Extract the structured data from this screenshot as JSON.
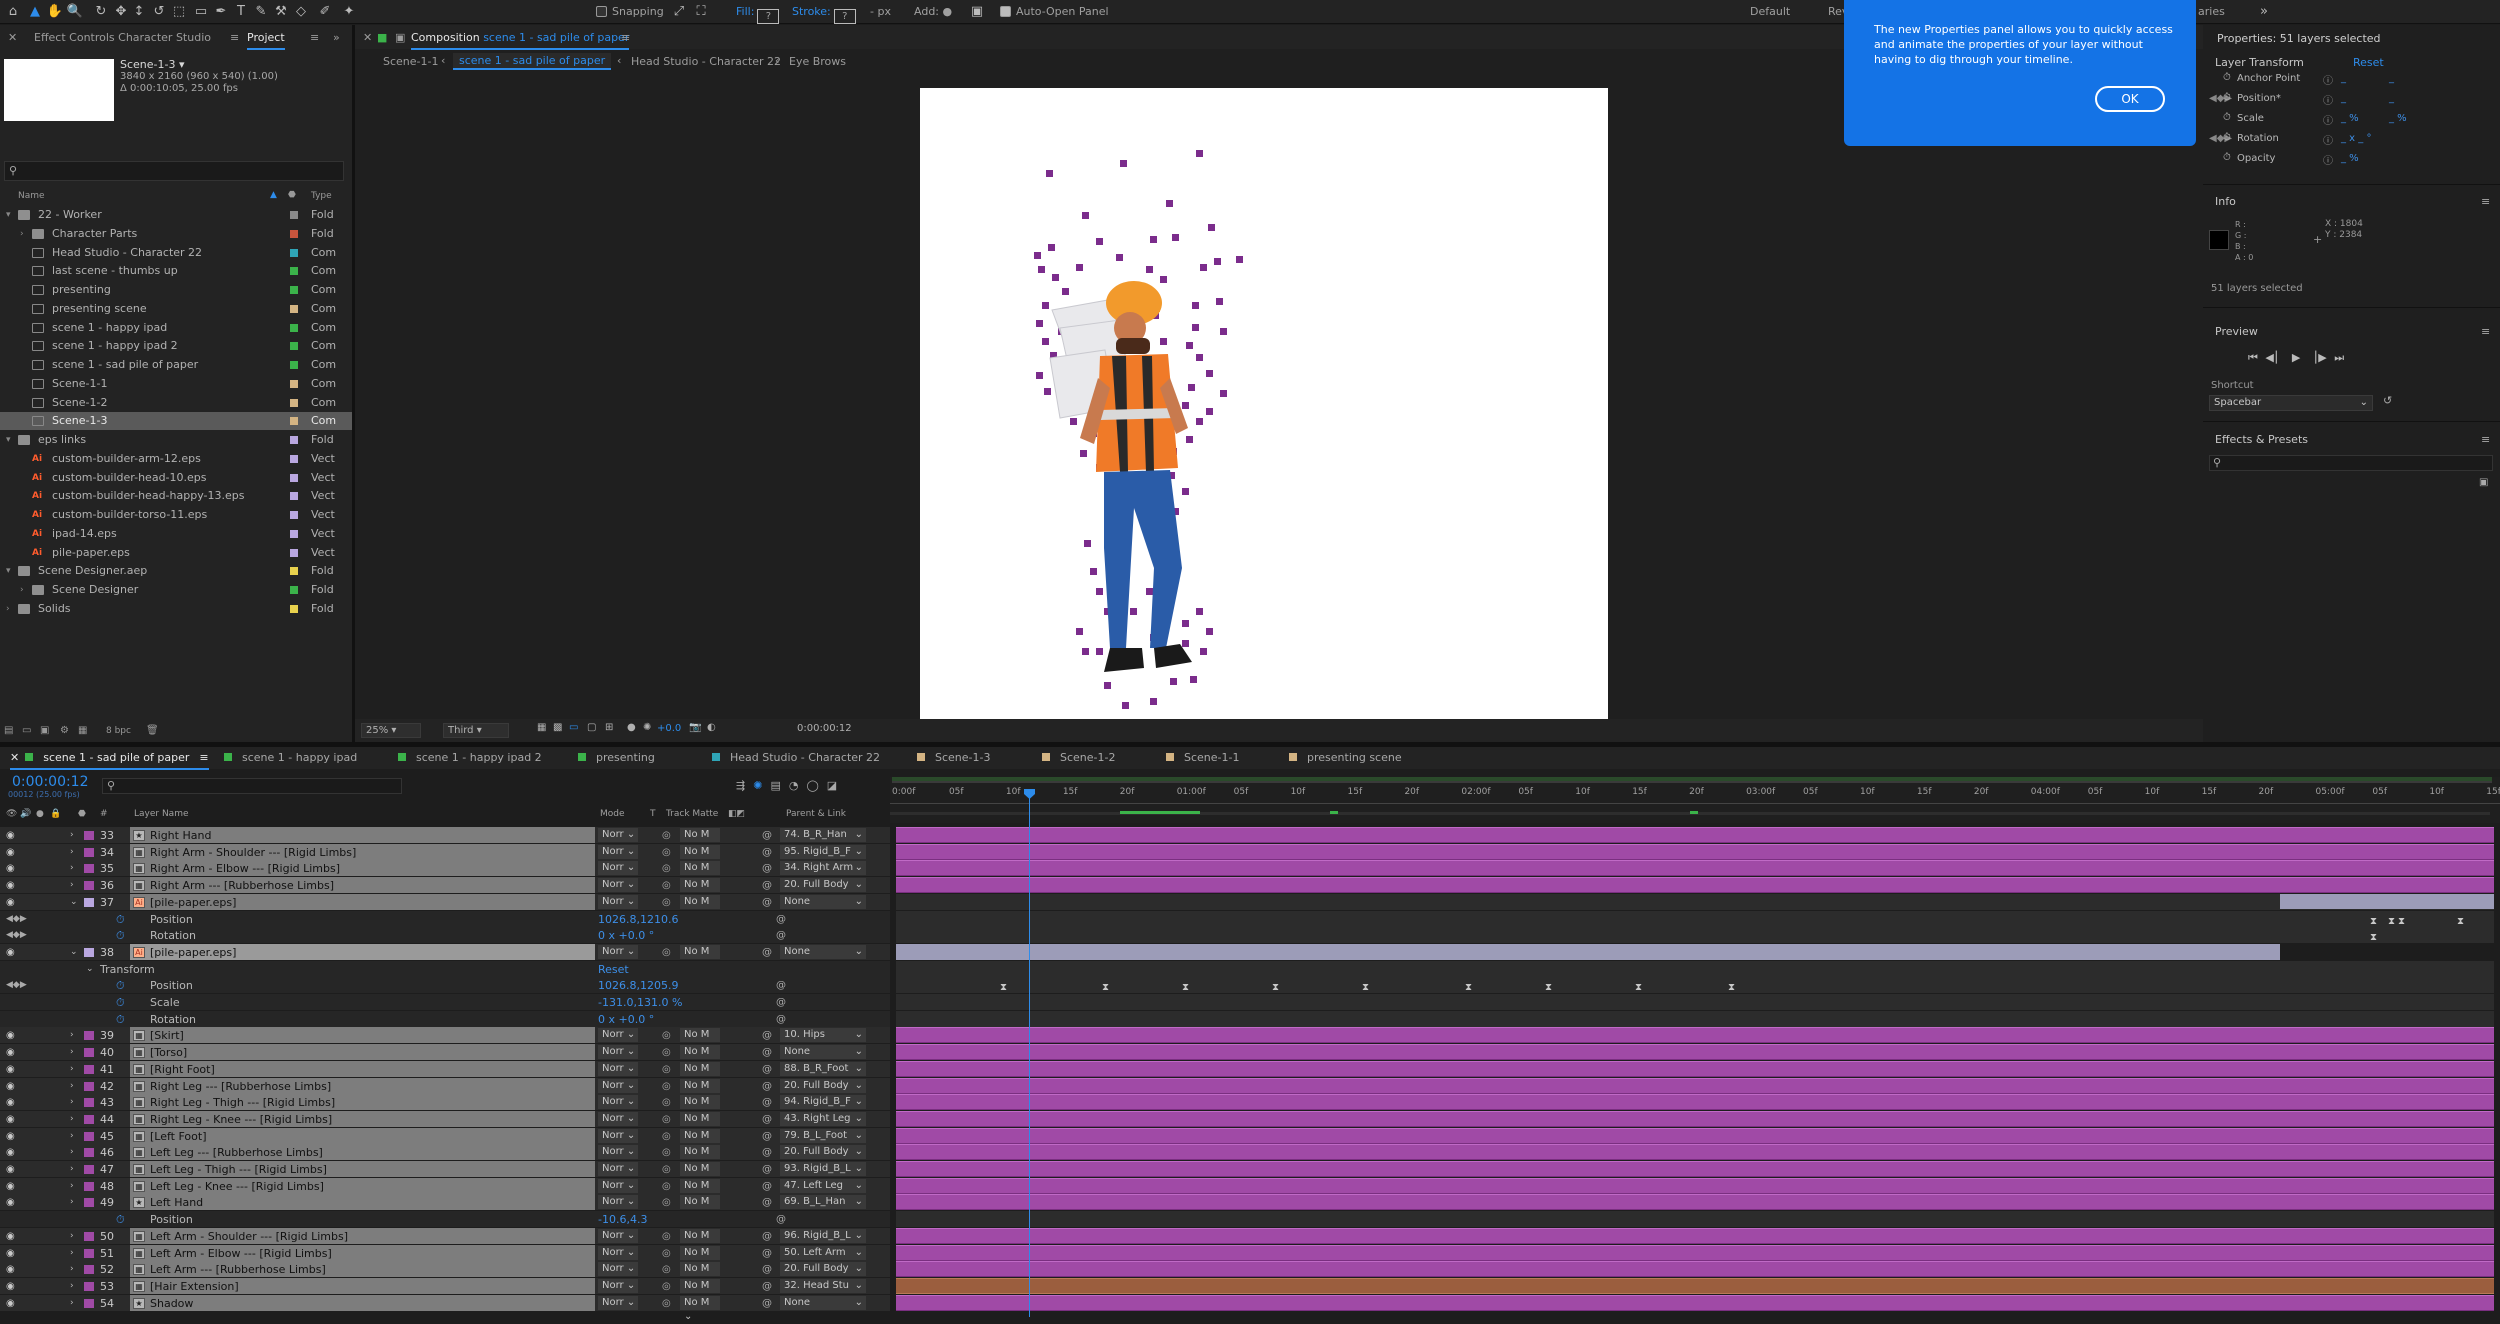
{
  "toolbar": {
    "snapping_label": "Snapping",
    "fill_label": "Fill:",
    "fill_value": "?",
    "stroke_label": "Stroke:",
    "stroke_value": "?",
    "px_label": "- px",
    "add_label": "Add:",
    "auto_open_label": "Auto-Open Panel",
    "workspace_default": "Default",
    "workspace_review": "Rev",
    "workspace_libraries": "aries"
  },
  "left_panel": {
    "tab_effect_controls": "Effect Controls Character Studio",
    "tab_project": "Project",
    "item_name": "Scene-1-3 ▾",
    "item_res": "3840 x 2160  (960 x 540) (1.00)",
    "item_dur": "Δ 0:00:10:05, 25.00 fps",
    "search_placeholder": "",
    "col_name": "Name",
    "col_type": "Type",
    "bpc": "8 bpc",
    "items": [
      {
        "name": "22 - Worker",
        "type": "Fold",
        "color": "#8a8a8a",
        "kind": "fold",
        "indent": 0,
        "tw": "▾"
      },
      {
        "name": "Character Parts",
        "type": "Fold",
        "color": "#c8553d",
        "kind": "fold",
        "indent": 1,
        "tw": "›"
      },
      {
        "name": "Head Studio - Character 22",
        "type": "Com",
        "color": "#2fa5b7",
        "kind": "comp",
        "indent": 1,
        "tw": ""
      },
      {
        "name": "last scene - thumbs up",
        "type": "Com",
        "color": "#3bb34a",
        "kind": "comp",
        "indent": 1,
        "tw": ""
      },
      {
        "name": "presenting",
        "type": "Com",
        "color": "#3bb34a",
        "kind": "comp",
        "indent": 1,
        "tw": ""
      },
      {
        "name": "presenting scene",
        "type": "Com",
        "color": "#d4b483",
        "kind": "comp",
        "indent": 1,
        "tw": ""
      },
      {
        "name": "scene 1 - happy ipad",
        "type": "Com",
        "color": "#3bb34a",
        "kind": "comp",
        "indent": 1,
        "tw": ""
      },
      {
        "name": "scene 1 - happy ipad 2",
        "type": "Com",
        "color": "#3bb34a",
        "kind": "comp",
        "indent": 1,
        "tw": ""
      },
      {
        "name": "scene 1 - sad pile of paper",
        "type": "Com",
        "color": "#3bb34a",
        "kind": "comp",
        "indent": 1,
        "tw": ""
      },
      {
        "name": "Scene-1-1",
        "type": "Com",
        "color": "#d4b483",
        "kind": "comp",
        "indent": 1,
        "tw": ""
      },
      {
        "name": "Scene-1-2",
        "type": "Com",
        "color": "#d4b483",
        "kind": "comp",
        "indent": 1,
        "tw": ""
      },
      {
        "name": "Scene-1-3",
        "type": "Com",
        "color": "#d4b483",
        "kind": "comp",
        "indent": 1,
        "tw": "",
        "selected": true
      },
      {
        "name": "eps links",
        "type": "Fold",
        "color": "#b9a7e0",
        "kind": "fold",
        "indent": 0,
        "tw": "▾"
      },
      {
        "name": "custom-builder-arm-12.eps",
        "type": "Vect",
        "color": "#b9a7e0",
        "kind": "ai",
        "indent": 1,
        "tw": ""
      },
      {
        "name": "custom-builder-head-10.eps",
        "type": "Vect",
        "color": "#b9a7e0",
        "kind": "ai",
        "indent": 1,
        "tw": ""
      },
      {
        "name": "custom-builder-head-happy-13.eps",
        "type": "Vect",
        "color": "#b9a7e0",
        "kind": "ai",
        "indent": 1,
        "tw": ""
      },
      {
        "name": "custom-builder-torso-11.eps",
        "type": "Vect",
        "color": "#b9a7e0",
        "kind": "ai",
        "indent": 1,
        "tw": ""
      },
      {
        "name": "ipad-14.eps",
        "type": "Vect",
        "color": "#b9a7e0",
        "kind": "ai",
        "indent": 1,
        "tw": ""
      },
      {
        "name": "pile-paper.eps",
        "type": "Vect",
        "color": "#b9a7e0",
        "kind": "ai",
        "indent": 1,
        "tw": ""
      },
      {
        "name": "Scene Designer.aep",
        "type": "Fold",
        "color": "#e8d14d",
        "kind": "fold",
        "indent": 0,
        "tw": "▾"
      },
      {
        "name": "Scene Designer",
        "type": "Fold",
        "color": "#3bb34a",
        "kind": "fold",
        "indent": 1,
        "tw": "›"
      },
      {
        "name": "Solids",
        "type": "Fold",
        "color": "#e8d14d",
        "kind": "fold",
        "indent": 0,
        "tw": "›"
      }
    ]
  },
  "viewer": {
    "panel_label": "Composition",
    "comp_name": "scene 1 - sad pile of paper",
    "breadcrumbs": [
      "Scene-1-1",
      "scene 1 - sad pile of paper",
      "Head Studio - Character 22",
      "Eye Brows"
    ],
    "zoom": "25%",
    "resolution": "Third",
    "exposure": "+0.0",
    "timecode": "0:00:00:12"
  },
  "tooltip": {
    "text": "The new Properties panel allows you to quickly access and animate the properties of your layer without having to dig through your timeline.",
    "ok": "OK"
  },
  "properties": {
    "title": "Properties: 51 layers selected",
    "section": "Layer Transform",
    "reset": "Reset",
    "rows": [
      {
        "name": "Anchor Point",
        "v1": "_",
        "v2": "_"
      },
      {
        "name": "Position*",
        "v1": "_",
        "v2": "_"
      },
      {
        "name": "Scale",
        "v1": "_ %",
        "v2": "_ %"
      },
      {
        "name": "Rotation",
        "v1": "_ x _ °",
        "v2": ""
      },
      {
        "name": "Opacity",
        "v1": "_ %",
        "v2": ""
      }
    ],
    "info_title": "Info",
    "info_rgb": [
      "R :",
      "G :",
      "B :",
      "A : 0"
    ],
    "info_x": "X : 1804",
    "info_y": "Y : 2384",
    "info_sel": "51 layers selected",
    "preview_title": "Preview",
    "shortcut_label": "Shortcut",
    "shortcut_value": "Spacebar",
    "effects_title": "Effects & Presets"
  },
  "timeline": {
    "tabs": [
      {
        "name": "scene 1 - sad pile of paper",
        "color": "#3bb34a",
        "selected": true
      },
      {
        "name": "scene 1 - happy ipad",
        "color": "#3bb34a"
      },
      {
        "name": "scene 1 - happy ipad 2",
        "color": "#3bb34a"
      },
      {
        "name": "presenting",
        "color": "#3bb34a"
      },
      {
        "name": "Head Studio - Character 22",
        "color": "#2fa5b7"
      },
      {
        "name": "Scene-1-3",
        "color": "#d4b483"
      },
      {
        "name": "Scene-1-2",
        "color": "#d4b483"
      },
      {
        "name": "Scene-1-1",
        "color": "#d4b483"
      },
      {
        "name": "presenting scene",
        "color": "#d4b483"
      }
    ],
    "timecode": "0:00:00:12",
    "fps_note": "00012 (25.00 fps)",
    "col_layer_name": "Layer Name",
    "col_mode": "Mode",
    "col_t": "T",
    "col_track_matte": "Track Matte",
    "col_parent": "Parent & Link",
    "ruler": [
      "0:00f",
      "05f",
      "10f",
      "15f",
      "20f",
      "01:00f",
      "05f",
      "10f",
      "15f",
      "20f",
      "02:00f",
      "05f",
      "10f",
      "15f",
      "20f",
      "03:00f",
      "05f",
      "10f",
      "15f",
      "20f",
      "04:00f",
      "05f",
      "10f",
      "15f",
      "20f",
      "05:00f",
      "05f",
      "10f",
      "15f"
    ],
    "rows": [
      {
        "type": "layer",
        "num": "33",
        "name": "Right Hand",
        "icon": "★",
        "mode": "Norr",
        "tm": "No M",
        "parent": "74. B_R_Han"
      },
      {
        "type": "layer",
        "num": "34",
        "name": "Right Arm - Shoulder --- [Rigid Limbs]",
        "icon": "▦",
        "mode": "Norr",
        "tm": "No M",
        "parent": "95. Rigid_B_F"
      },
      {
        "type": "layer",
        "num": "35",
        "name": "Right Arm - Elbow --- [Rigid Limbs]",
        "icon": "▦",
        "mode": "Norr",
        "tm": "No M",
        "parent": "34. Right Arm"
      },
      {
        "type": "layer",
        "num": "36",
        "name": "Right Arm --- [Rubberhose Limbs]",
        "icon": "▦",
        "mode": "Norr",
        "tm": "No M",
        "parent": "20. Full Body"
      },
      {
        "type": "layer",
        "num": "37",
        "name": "[pile-paper.eps]",
        "icon": "Ai",
        "mode": "Norr",
        "tm": "No M",
        "parent": "None",
        "bar": "grey",
        "open": true
      },
      {
        "type": "prop",
        "name": "Position",
        "value": "1026.8,1210.6",
        "kfs": [
          2370,
          2388,
          2398,
          2457,
          2503
        ]
      },
      {
        "type": "prop",
        "name": "Rotation",
        "value": "0 x +0.0 °",
        "kfs": [
          2370
        ]
      },
      {
        "type": "layer",
        "num": "38",
        "name": "[pile-paper.eps]",
        "icon": "Ai",
        "mode": "Norr",
        "tm": "No M",
        "parent": "None",
        "bar": "grey",
        "open": true,
        "selected": true
      },
      {
        "type": "group",
        "name": "Transform",
        "value": "Reset"
      },
      {
        "type": "prop",
        "name": "Position",
        "value": "1026.8,1205.9",
        "kfs": [
          1000,
          1102,
          1182,
          1272,
          1362,
          1465,
          1545,
          1635,
          1728
        ]
      },
      {
        "type": "prop",
        "name": "Scale",
        "value": "-131.0,131.0 %",
        "kfs": []
      },
      {
        "type": "prop",
        "name": "Rotation",
        "value": "0 x +0.0 °",
        "kfs": []
      },
      {
        "type": "layer",
        "num": "39",
        "name": "[Skirt]",
        "icon": "▦",
        "mode": "Norr",
        "tm": "No M",
        "parent": "10. Hips"
      },
      {
        "type": "layer",
        "num": "40",
        "name": "[Torso]",
        "icon": "▦",
        "mode": "Norr",
        "tm": "No M",
        "parent": "None"
      },
      {
        "type": "layer",
        "num": "41",
        "name": "[Right Foot]",
        "icon": "▦",
        "mode": "Norr",
        "tm": "No M",
        "parent": "88. B_R_Foot"
      },
      {
        "type": "layer",
        "num": "42",
        "name": "Right Leg --- [Rubberhose Limbs]",
        "icon": "▦",
        "mode": "Norr",
        "tm": "No M",
        "parent": "20. Full Body"
      },
      {
        "type": "layer",
        "num": "43",
        "name": "Right Leg - Thigh --- [Rigid Limbs]",
        "icon": "▦",
        "mode": "Norr",
        "tm": "No M",
        "parent": "94. Rigid_B_F"
      },
      {
        "type": "layer",
        "num": "44",
        "name": "Right Leg - Knee --- [Rigid Limbs]",
        "icon": "▦",
        "mode": "Norr",
        "tm": "No M",
        "parent": "43. Right Leg"
      },
      {
        "type": "layer",
        "num": "45",
        "name": "[Left Foot]",
        "icon": "▦",
        "mode": "Norr",
        "tm": "No M",
        "parent": "79. B_L_Foot"
      },
      {
        "type": "layer",
        "num": "46",
        "name": "Left Leg --- [Rubberhose Limbs]",
        "icon": "▦",
        "mode": "Norr",
        "tm": "No M",
        "parent": "20. Full Body"
      },
      {
        "type": "layer",
        "num": "47",
        "name": "Left Leg - Thigh --- [Rigid Limbs]",
        "icon": "▦",
        "mode": "Norr",
        "tm": "No M",
        "parent": "93. Rigid_B_L"
      },
      {
        "type": "layer",
        "num": "48",
        "name": "Left Leg - Knee --- [Rigid Limbs]",
        "icon": "▦",
        "mode": "Norr",
        "tm": "No M",
        "parent": "47. Left Leg"
      },
      {
        "type": "layer",
        "num": "49",
        "name": "Left Hand",
        "icon": "★",
        "mode": "Norr",
        "tm": "No M",
        "parent": "69. B_L_Han"
      },
      {
        "type": "prop",
        "name": "Position",
        "value": "-10.6,4.3",
        "kfs": []
      },
      {
        "type": "layer",
        "num": "50",
        "name": "Left Arm - Shoulder --- [Rigid Limbs]",
        "icon": "▦",
        "mode": "Norr",
        "tm": "No M",
        "parent": "96. Rigid_B_L"
      },
      {
        "type": "layer",
        "num": "51",
        "name": "Left Arm - Elbow --- [Rigid Limbs]",
        "icon": "▦",
        "mode": "Norr",
        "tm": "No M",
        "parent": "50. Left Arm"
      },
      {
        "type": "layer",
        "num": "52",
        "name": "Left Arm --- [Rubberhose Limbs]",
        "icon": "▦",
        "mode": "Norr",
        "tm": "No M",
        "parent": "20. Full Body"
      },
      {
        "type": "layer",
        "num": "53",
        "name": "[Hair Extension]",
        "icon": "▦",
        "mode": "Norr",
        "tm": "No M",
        "parent": "32. Head Stu",
        "bar": "brown"
      },
      {
        "type": "layer",
        "num": "54",
        "name": "Shadow",
        "icon": "★",
        "mode": "Norr",
        "tm": "No M",
        "parent": "None"
      }
    ]
  }
}
